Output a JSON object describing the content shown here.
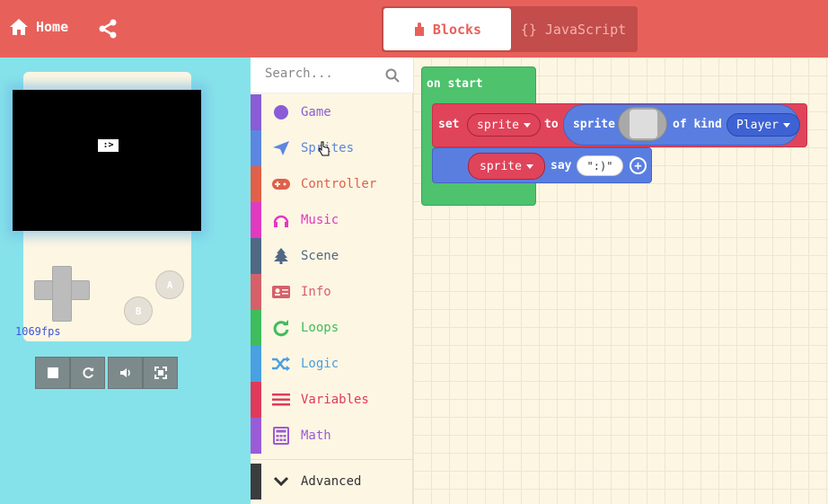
{
  "header": {
    "home_label": "Home",
    "blocks_label": "Blocks",
    "javascript_label": "{} JavaScript"
  },
  "simulator": {
    "sprite_text": ":>",
    "fps": "1069fps",
    "button_a": "A",
    "button_b": "B"
  },
  "toolbox": {
    "search_placeholder": "Search...",
    "categories": [
      {
        "label": "Game",
        "color": "#8a5cd6",
        "icon": "circle-icon"
      },
      {
        "label": "Sprites",
        "color": "#5c86e0",
        "icon": "paper-plane-icon"
      },
      {
        "label": "Controller",
        "color": "#e0604a",
        "icon": "gamepad-icon"
      },
      {
        "label": "Music",
        "color": "#e03ac0",
        "icon": "headphones-icon"
      },
      {
        "label": "Scene",
        "color": "#506884",
        "icon": "tree-icon"
      },
      {
        "label": "Info",
        "color": "#d6606a",
        "icon": "id-card-icon"
      },
      {
        "label": "Loops",
        "color": "#3fbc5c",
        "icon": "refresh-icon"
      },
      {
        "label": "Logic",
        "color": "#4aa0e0",
        "icon": "shuffle-icon"
      },
      {
        "label": "Variables",
        "color": "#e03a5a",
        "icon": "list-icon"
      },
      {
        "label": "Math",
        "color": "#9a5cd6",
        "icon": "calculator-icon"
      }
    ],
    "advanced_label": "Advanced"
  },
  "workspace": {
    "on_start_label": "on start",
    "set_label": "set",
    "set_var": "sprite",
    "to_label": "to",
    "sprite_label": "sprite",
    "of_kind_label": "of kind",
    "kind_value": "Player",
    "say_var": "sprite",
    "say_label": "say",
    "say_text": "\":)\""
  }
}
